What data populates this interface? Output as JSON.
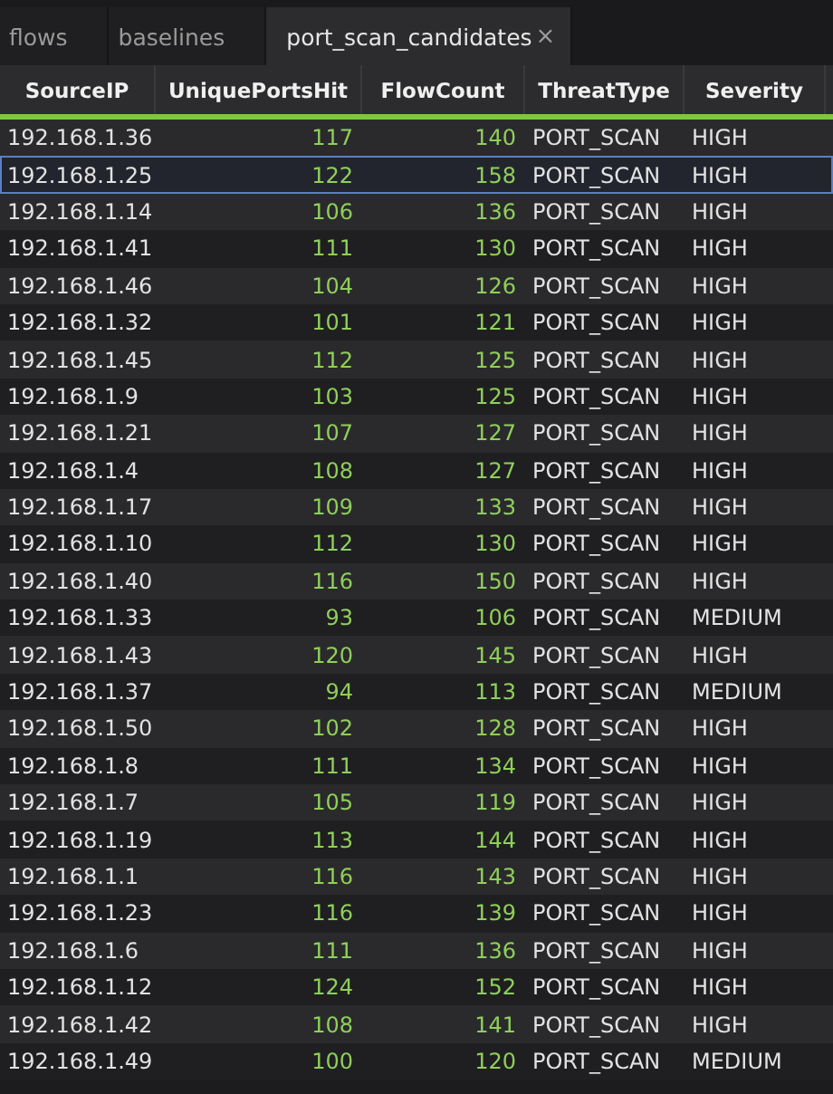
{
  "tabs": [
    {
      "label": "flows",
      "selected": false
    },
    {
      "label": "baselines",
      "selected": false
    },
    {
      "label": "port_scan_candidates",
      "selected": true,
      "close": "×"
    }
  ],
  "table": {
    "columns": [
      {
        "label": "SourceIP",
        "kind": "text"
      },
      {
        "label": "UniquePortsHit",
        "kind": "number"
      },
      {
        "label": "FlowCount",
        "kind": "number"
      },
      {
        "label": "ThreatType",
        "kind": "text"
      },
      {
        "label": "Severity",
        "kind": "text"
      }
    ],
    "rows": [
      {
        "selected": false,
        "cells": [
          "192.168.1.36",
          "117",
          "140",
          "PORT_SCAN",
          "HIGH"
        ]
      },
      {
        "selected": true,
        "cells": [
          "192.168.1.25",
          "122",
          "158",
          "PORT_SCAN",
          "HIGH"
        ]
      },
      {
        "selected": false,
        "cells": [
          "192.168.1.14",
          "106",
          "136",
          "PORT_SCAN",
          "HIGH"
        ]
      },
      {
        "selected": false,
        "cells": [
          "192.168.1.41",
          "111",
          "130",
          "PORT_SCAN",
          "HIGH"
        ]
      },
      {
        "selected": false,
        "cells": [
          "192.168.1.46",
          "104",
          "126",
          "PORT_SCAN",
          "HIGH"
        ]
      },
      {
        "selected": false,
        "cells": [
          "192.168.1.32",
          "101",
          "121",
          "PORT_SCAN",
          "HIGH"
        ]
      },
      {
        "selected": false,
        "cells": [
          "192.168.1.45",
          "112",
          "125",
          "PORT_SCAN",
          "HIGH"
        ]
      },
      {
        "selected": false,
        "cells": [
          "192.168.1.9",
          "103",
          "125",
          "PORT_SCAN",
          "HIGH"
        ]
      },
      {
        "selected": false,
        "cells": [
          "192.168.1.21",
          "107",
          "127",
          "PORT_SCAN",
          "HIGH"
        ]
      },
      {
        "selected": false,
        "cells": [
          "192.168.1.4",
          "108",
          "127",
          "PORT_SCAN",
          "HIGH"
        ]
      },
      {
        "selected": false,
        "cells": [
          "192.168.1.17",
          "109",
          "133",
          "PORT_SCAN",
          "HIGH"
        ]
      },
      {
        "selected": false,
        "cells": [
          "192.168.1.10",
          "112",
          "130",
          "PORT_SCAN",
          "HIGH"
        ]
      },
      {
        "selected": false,
        "cells": [
          "192.168.1.40",
          "116",
          "150",
          "PORT_SCAN",
          "HIGH"
        ]
      },
      {
        "selected": false,
        "cells": [
          "192.168.1.33",
          "93",
          "106",
          "PORT_SCAN",
          "MEDIUM"
        ]
      },
      {
        "selected": false,
        "cells": [
          "192.168.1.43",
          "120",
          "145",
          "PORT_SCAN",
          "HIGH"
        ]
      },
      {
        "selected": false,
        "cells": [
          "192.168.1.37",
          "94",
          "113",
          "PORT_SCAN",
          "MEDIUM"
        ]
      },
      {
        "selected": false,
        "cells": [
          "192.168.1.50",
          "102",
          "128",
          "PORT_SCAN",
          "HIGH"
        ]
      },
      {
        "selected": false,
        "cells": [
          "192.168.1.8",
          "111",
          "134",
          "PORT_SCAN",
          "HIGH"
        ]
      },
      {
        "selected": false,
        "cells": [
          "192.168.1.7",
          "105",
          "119",
          "PORT_SCAN",
          "HIGH"
        ]
      },
      {
        "selected": false,
        "cells": [
          "192.168.1.19",
          "113",
          "144",
          "PORT_SCAN",
          "HIGH"
        ]
      },
      {
        "selected": false,
        "cells": [
          "192.168.1.1",
          "116",
          "143",
          "PORT_SCAN",
          "HIGH"
        ]
      },
      {
        "selected": false,
        "cells": [
          "192.168.1.23",
          "116",
          "139",
          "PORT_SCAN",
          "HIGH"
        ]
      },
      {
        "selected": false,
        "cells": [
          "192.168.1.6",
          "111",
          "136",
          "PORT_SCAN",
          "HIGH"
        ]
      },
      {
        "selected": false,
        "cells": [
          "192.168.1.12",
          "124",
          "152",
          "PORT_SCAN",
          "HIGH"
        ]
      },
      {
        "selected": false,
        "cells": [
          "192.168.1.42",
          "108",
          "141",
          "PORT_SCAN",
          "HIGH"
        ]
      },
      {
        "selected": false,
        "cells": [
          "192.168.1.49",
          "100",
          "120",
          "PORT_SCAN",
          "MEDIUM"
        ]
      }
    ]
  }
}
